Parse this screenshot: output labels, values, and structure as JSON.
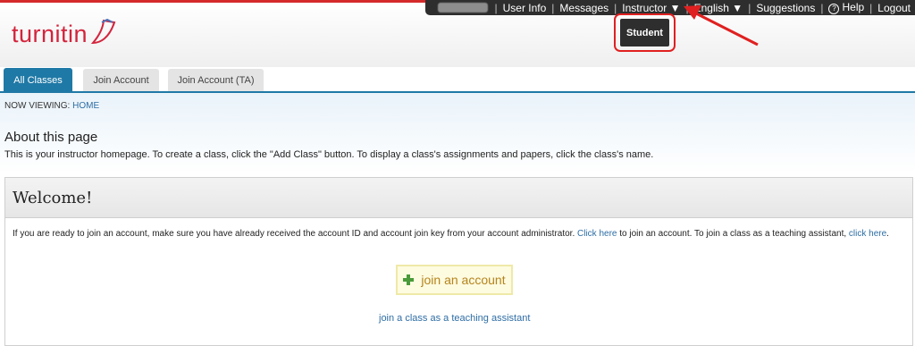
{
  "logo": {
    "text": "turnitin"
  },
  "utility_bar": {
    "items": [
      "User Info",
      "Messages",
      "Instructor ▼",
      "English ▼",
      "Suggestions",
      "Help",
      "Logout"
    ],
    "help_icon": "question-circle-icon"
  },
  "role_menu": {
    "student": "Student"
  },
  "tabs": [
    {
      "label": "All Classes",
      "active": true
    },
    {
      "label": "Join Account",
      "active": false
    },
    {
      "label": "Join Account (TA)",
      "active": false
    }
  ],
  "now_viewing": {
    "prefix": "NOW VIEWING: ",
    "page": "HOME"
  },
  "about": {
    "title": "About this page",
    "text": "This is your instructor homepage. To create a class, click the \"Add Class\" button. To display a class's assignments and papers, click the class's name."
  },
  "welcome": {
    "title": "Welcome!",
    "text_1": "If you are ready to join an account, make sure you have already received the account ID and account join key from your account administrator. ",
    "link_1": "Click here",
    "text_2": " to join an account. To join a class as a teaching assistant, ",
    "link_2": "click here",
    "text_3": ".",
    "join_button": "join an account",
    "ta_link": "join a class as a teaching assistant"
  },
  "colors": {
    "brand_red": "#d3243c",
    "tab_blue": "#1f79a6",
    "link_blue": "#2e6da4",
    "annotation_red": "#e02020"
  }
}
